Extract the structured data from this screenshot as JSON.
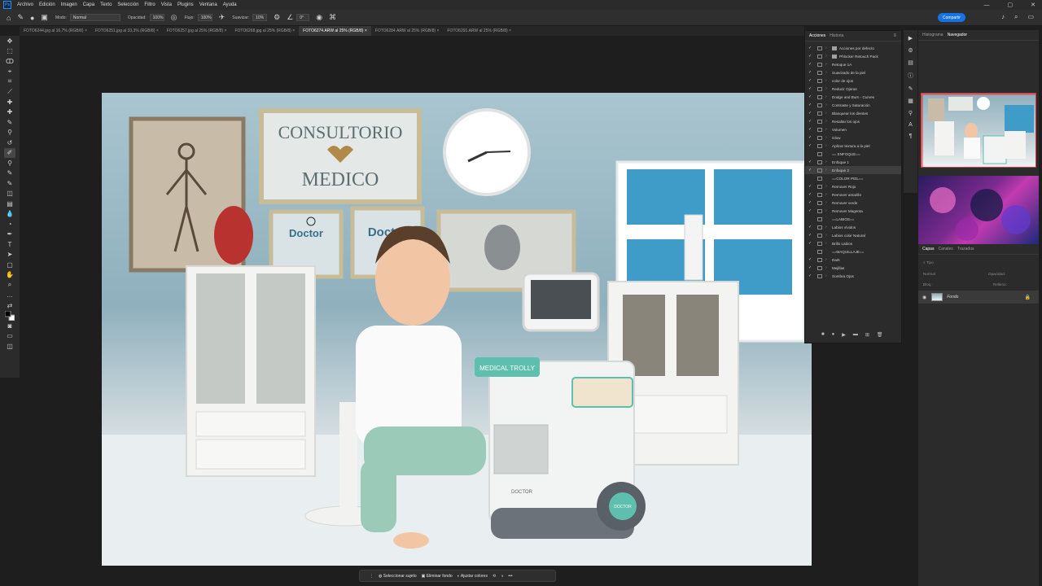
{
  "menubar": {
    "logo": "Ps",
    "items": [
      "Archivo",
      "Edición",
      "Imagen",
      "Capa",
      "Texto",
      "Selección",
      "Filtro",
      "Vista",
      "Plugins",
      "Ventana",
      "Ayuda"
    ],
    "window_controls": [
      "—",
      "▢",
      "✕"
    ]
  },
  "options": {
    "mode_label": "Modo:",
    "mode_value": "Normal",
    "opacity_label": "Opacidad:",
    "opacity_value": "100%",
    "flow_label": "Flujo:",
    "flow_value": "100%",
    "smoothing_label": "Suavizar:",
    "smoothing_value": "10%",
    "angle_value": "0°",
    "share_label": "Compartir"
  },
  "tabs": [
    {
      "label": "FOTO6244.jpg al 16,7% (RGB/8)",
      "close": "×"
    },
    {
      "label": "FOTO6251.jpg al 33,3% (RGB/8)",
      "close": "×"
    },
    {
      "label": "FOTO6257.jpg al 25% (RGB/8)",
      "close": "×"
    },
    {
      "label": "FOTO6268.jpg al 25% (RGB/8)",
      "close": "×"
    },
    {
      "label": "FOTO6274.ARW al 25% (RGB/8)",
      "close": "×"
    },
    {
      "label": "FOTO6284.ARW al 25% (RGB/8)",
      "close": "×"
    },
    {
      "label": "FOTO6291.ARW al 25% (RGB/8)",
      "close": "×"
    }
  ],
  "photo": {
    "sign_line1": "CONSULTORIO",
    "sign_line2": "MEDICO",
    "doctor_text": "Doctor",
    "trolley_text": "MEDICAL TROLLY",
    "wheel_text": "DOCTOR",
    "cart_text": "DOCTOR"
  },
  "contextbar": {
    "select_subject": "Seleccionar sujeto",
    "remove_bg": "Eliminar fondo",
    "adjust_colors": "Ajustar colores"
  },
  "actions_panel": {
    "tab_actions": "Acciones",
    "tab_history": "Historia",
    "items": [
      {
        "label": "Acciones por defecto",
        "type": "folder"
      },
      {
        "label": "Phlocker Retouch Pack",
        "type": "folder"
      },
      {
        "label": "Retoque 1A",
        "type": "action"
      },
      {
        "label": "Suavizado de la piel",
        "type": "action"
      },
      {
        "label": "color de ojos",
        "type": "action"
      },
      {
        "label": "Reducir Ojeras",
        "type": "action"
      },
      {
        "label": "Dodge and Burn - Curves",
        "type": "action"
      },
      {
        "label": "Contraste y Saturación",
        "type": "action"
      },
      {
        "label": "Blanquear los dientes",
        "type": "action"
      },
      {
        "label": "Resaltar los ojos",
        "type": "action"
      },
      {
        "label": "Volumen",
        "type": "action"
      },
      {
        "label": "Glow",
        "type": "action"
      },
      {
        "label": "Aplicar textura a la piel",
        "type": "action"
      },
      {
        "label": "== ENFOQUE==",
        "type": "separator"
      },
      {
        "label": "Enfoque 1",
        "type": "action"
      },
      {
        "label": "Enfoque 2",
        "type": "action",
        "selected": true
      },
      {
        "label": "==COLOR PIEL==",
        "type": "separator"
      },
      {
        "label": "Remover Rojo",
        "type": "action"
      },
      {
        "label": "Remover amarillo",
        "type": "action"
      },
      {
        "label": "Remover verde",
        "type": "action"
      },
      {
        "label": "Remover Magenta",
        "type": "action"
      },
      {
        "label": "==LABIOS==",
        "type": "separator"
      },
      {
        "label": "Labios vívidos",
        "type": "action"
      },
      {
        "label": "Labios color Natural",
        "type": "action"
      },
      {
        "label": "Brillo Labios",
        "type": "action"
      },
      {
        "label": "==MAQUILLAJE==",
        "type": "separator"
      },
      {
        "label": "Dark",
        "type": "action"
      },
      {
        "label": "Mejillas",
        "type": "action"
      },
      {
        "label": "Sombra Ojos",
        "type": "action"
      }
    ]
  },
  "navigator": {
    "tab_histogram": "Histograma",
    "tab_navigator": "Navegador"
  },
  "layers": {
    "tab_layers": "Capas",
    "tab_channels": "Canales",
    "tab_paths": "Trazados",
    "search_placeholder": "Tipo",
    "blend_mode": "Normal",
    "opacity_label": "Opacidad:",
    "fill_label": "Relleno:",
    "lock_label": "Bloq.:",
    "layer_name": "Fondo"
  }
}
